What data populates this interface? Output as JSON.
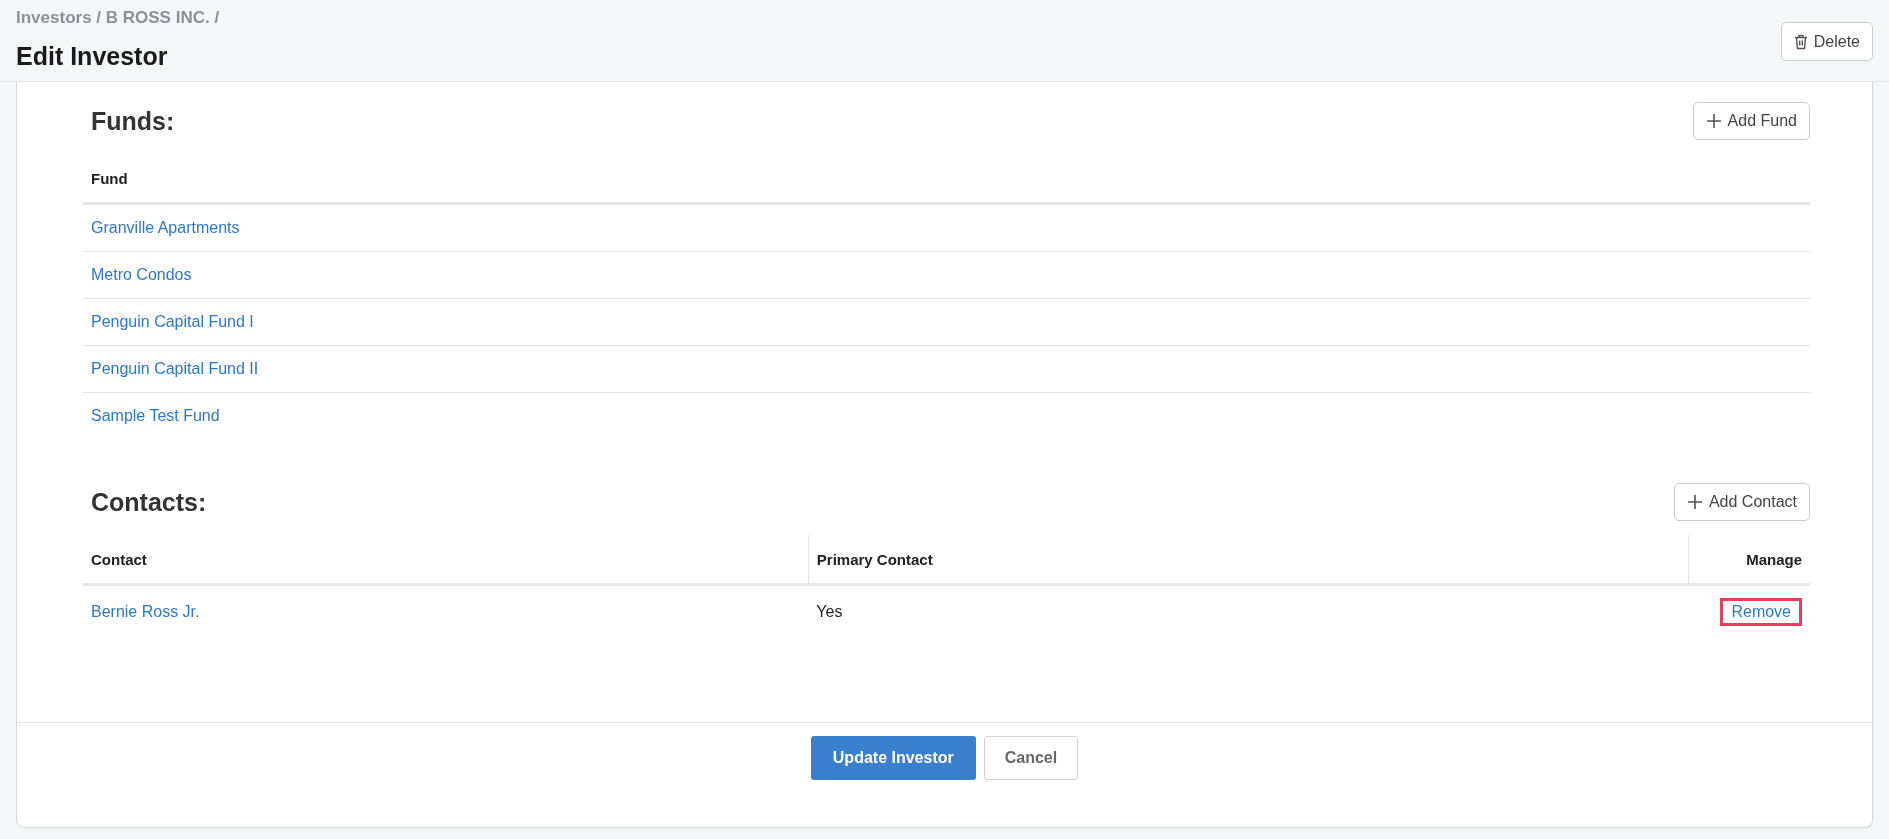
{
  "breadcrumb": "Investors / B ROSS INC. /",
  "page_title": "Edit Investor",
  "delete_button": "Delete",
  "funds": {
    "heading": "Funds:",
    "add_button": "Add Fund",
    "columns": [
      "Fund"
    ],
    "rows": [
      "Granville Apartments",
      "Metro Condos",
      "Penguin Capital Fund I",
      "Penguin Capital Fund II",
      "Sample Test Fund"
    ]
  },
  "contacts": {
    "heading": "Contacts:",
    "add_button": "Add Contact",
    "columns": [
      "Contact",
      "Primary Contact",
      "Manage"
    ],
    "rows": [
      {
        "contact": "Bernie Ross Jr.",
        "primary": "Yes",
        "action": "Remove",
        "highlighted": true
      }
    ]
  },
  "footer": {
    "primary_button": "Update Investor",
    "cancel_button": "Cancel"
  }
}
